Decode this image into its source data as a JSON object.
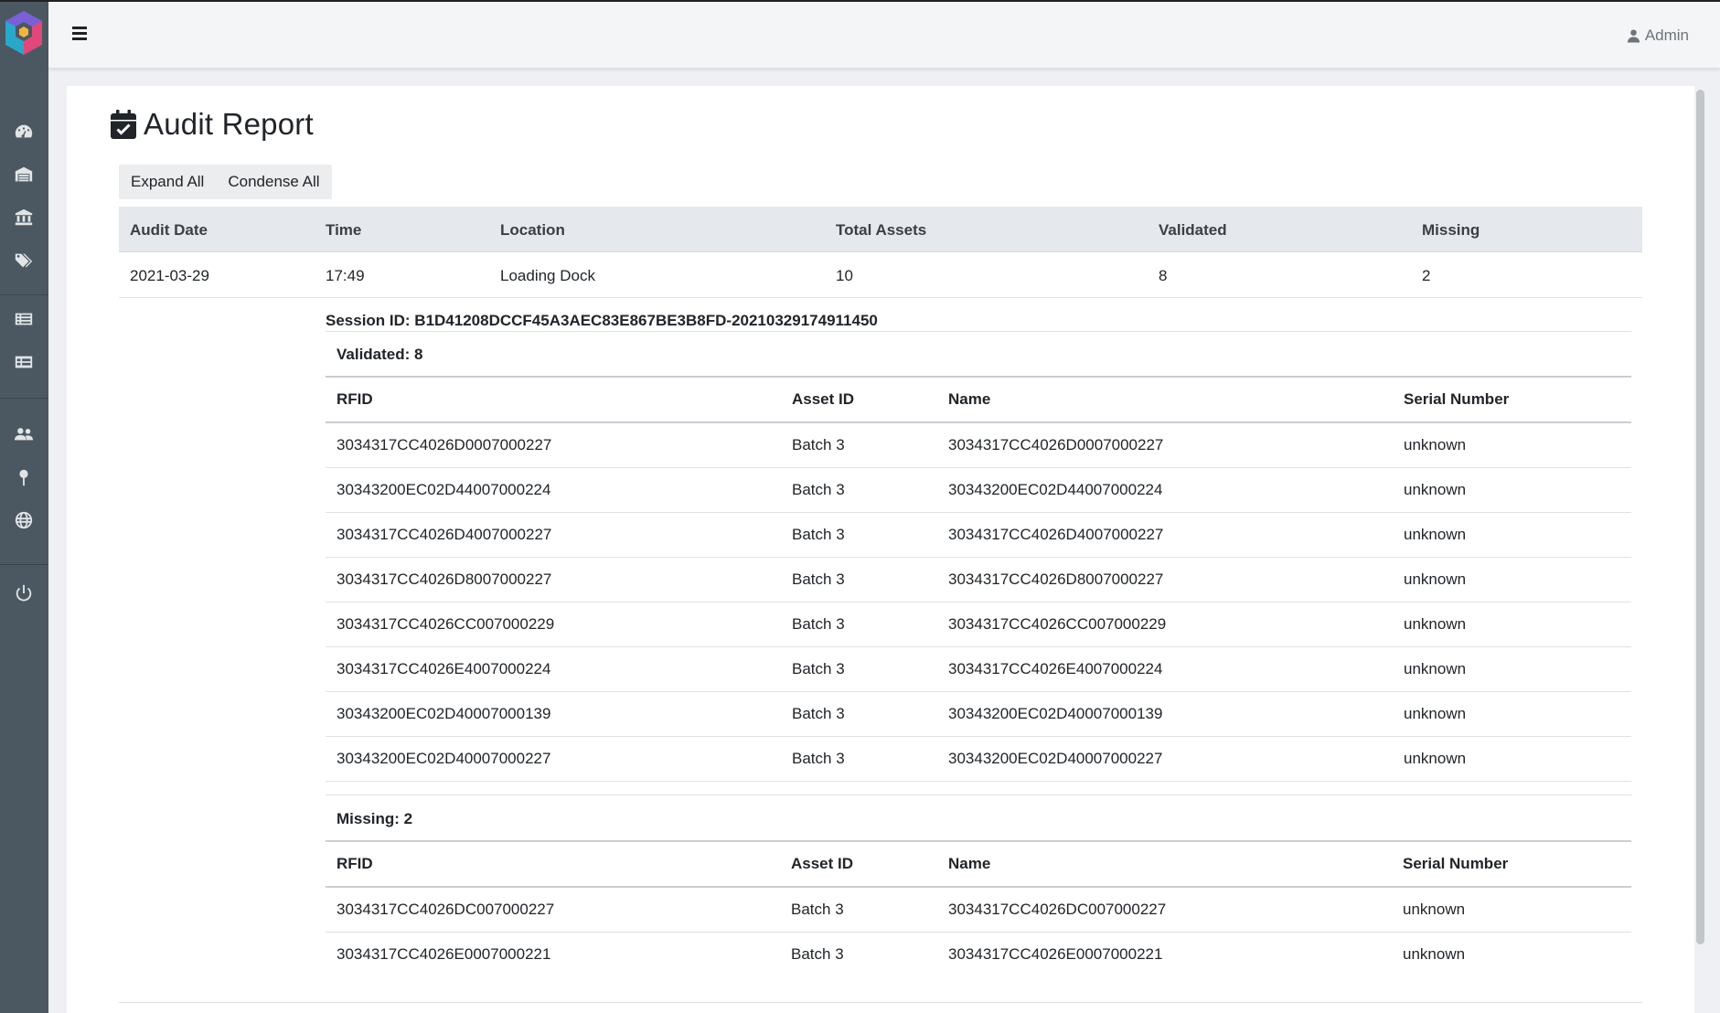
{
  "header": {
    "user_label": "Admin"
  },
  "page": {
    "title": "Audit Report"
  },
  "toolbar": {
    "expand_label": "Expand All",
    "condense_label": "Condense All"
  },
  "audit_table": {
    "columns": [
      "Audit Date",
      "Time",
      "Location",
      "Total Assets",
      "Validated",
      "Missing"
    ],
    "rows": [
      {
        "audit_date": "2021-03-29",
        "time": "17:49",
        "location": "Loading Dock",
        "total_assets": "10",
        "validated": "8",
        "missing": "2"
      }
    ]
  },
  "session": {
    "label": "Session ID: B1D41208DCCF45A3AEC83E867BE3B8FD-20210329174911450"
  },
  "asset_columns": [
    "RFID",
    "Asset ID",
    "Name",
    "Serial Number"
  ],
  "validated": {
    "label": "Validated: 8",
    "rows": [
      {
        "rfid": "3034317CC4026D0007000227",
        "asset_id": "Batch 3",
        "name": "3034317CC4026D0007000227",
        "serial": "unknown"
      },
      {
        "rfid": "30343200EC02D44007000224",
        "asset_id": "Batch 3",
        "name": "30343200EC02D44007000224",
        "serial": "unknown"
      },
      {
        "rfid": "3034317CC4026D4007000227",
        "asset_id": "Batch 3",
        "name": "3034317CC4026D4007000227",
        "serial": "unknown"
      },
      {
        "rfid": "3034317CC4026D8007000227",
        "asset_id": "Batch 3",
        "name": "3034317CC4026D8007000227",
        "serial": "unknown"
      },
      {
        "rfid": "3034317CC4026CC007000229",
        "asset_id": "Batch 3",
        "name": "3034317CC4026CC007000229",
        "serial": "unknown"
      },
      {
        "rfid": "3034317CC4026E4007000224",
        "asset_id": "Batch 3",
        "name": "3034317CC4026E4007000224",
        "serial": "unknown"
      },
      {
        "rfid": "30343200EC02D40007000139",
        "asset_id": "Batch 3",
        "name": "30343200EC02D40007000139",
        "serial": "unknown"
      },
      {
        "rfid": "30343200EC02D40007000227",
        "asset_id": "Batch 3",
        "name": "30343200EC02D40007000227",
        "serial": "unknown"
      }
    ]
  },
  "missing": {
    "label": "Missing: 2",
    "rows": [
      {
        "rfid": "3034317CC4026DC007000227",
        "asset_id": "Batch 3",
        "name": "3034317CC4026DC007000227",
        "serial": "unknown"
      },
      {
        "rfid": "3034317CC4026E0007000221",
        "asset_id": "Batch 3",
        "name": "3034317CC4026E0007000221",
        "serial": "unknown"
      }
    ]
  },
  "sidebar": {
    "items": [
      {
        "icon": "dashboard-icon"
      },
      {
        "icon": "warehouse-icon"
      },
      {
        "icon": "bank-icon"
      },
      {
        "icon": "tags-icon"
      },
      {
        "icon": "list-alt-icon"
      },
      {
        "icon": "table-list-icon"
      },
      {
        "icon": "users-icon"
      },
      {
        "icon": "map-pin-icon"
      },
      {
        "icon": "globe-icon"
      },
      {
        "icon": "power-icon"
      }
    ]
  },
  "colors": {
    "sidebar": "#4c5861",
    "topbar": "#f4f5f6",
    "table_head": "#e5e8ec",
    "logo_primary": "#3a6fd8",
    "logo_accent": "#e0487a"
  }
}
